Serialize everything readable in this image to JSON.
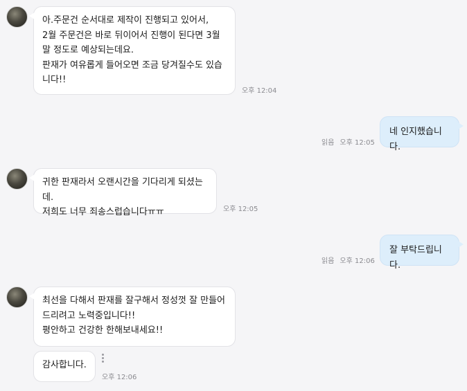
{
  "messages": [
    {
      "text": "아.주문건 순서대로 제작이 진행되고 있어서,\n2월 주문건은 바로 뒤이어서 진행이 된다면 3월말 정도로 예상되는데요.\n판재가 여유롭게 들어오면 조금 당겨질수도 있습니다!!",
      "time": "오후 12:04"
    },
    {
      "text": "네 인지했습니다.",
      "read": "읽음",
      "time": "오후 12:05"
    },
    {
      "text": "귀한 판재라서 오랜시간을 기다리게 되셨는데.\n저희도 너무 죄송스럽습니다ㅠㅠ",
      "time": "오후 12:05"
    },
    {
      "text": "잘 부탁드립니다.",
      "read": "읽음",
      "time": "오후 12:06"
    },
    {
      "text": "최선을 다해서 판재를 잘구해서 정성껏 잘 만들어 드리려고 노력중입니다!!\n평안하고 건강한 한해보내세요!!",
      "time": ""
    },
    {
      "text": "감사합니다.",
      "time": "오후 12:06"
    }
  ]
}
